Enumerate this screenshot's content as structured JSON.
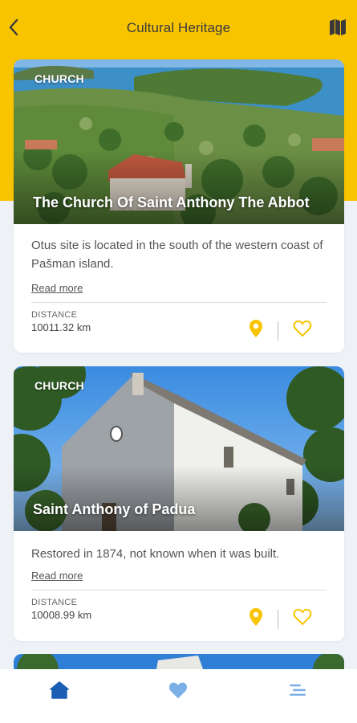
{
  "header": {
    "title": "Cultural Heritage",
    "back_icon": "chevron-left-icon",
    "map_icon": "map-icon"
  },
  "colors": {
    "accent": "#f8c400",
    "nav_active": "#1a5fb4",
    "nav_inactive": "#7ab0e6"
  },
  "cards": [
    {
      "badge": "CHURCH",
      "title": "The Church Of Saint Anthony The Abbot",
      "description": "Otus site is located in the south of the western coast of Pašman island.",
      "read_more": "Read more",
      "distance_label": "DISTANCE",
      "distance_value": "10011.32 km"
    },
    {
      "badge": "CHURCH",
      "title": "Saint Anthony of Padua",
      "description": "Restored in 1874, not known when it was built.",
      "read_more": "Read more",
      "distance_label": "DISTANCE",
      "distance_value": "10008.99 km"
    }
  ],
  "bottom_nav": [
    {
      "name": "home",
      "icon": "home-icon",
      "active": true
    },
    {
      "name": "favorites",
      "icon": "heart-icon",
      "active": false
    },
    {
      "name": "menu",
      "icon": "menu-icon",
      "active": false
    }
  ]
}
